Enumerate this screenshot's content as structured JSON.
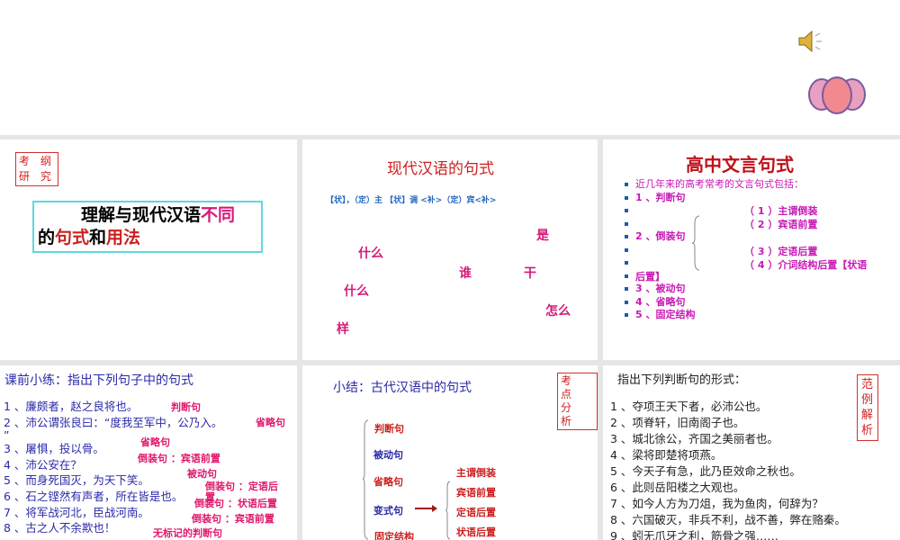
{
  "slides": [
    {
      "stamp": [
        "考 纲",
        "研 究"
      ],
      "title_parts": [
        "理解与现代汉语",
        "不同",
        "的",
        "句式",
        "和",
        "用法"
      ]
    },
    {
      "title": "现代汉语的句式",
      "formula": "【状】，（定）主 【状】调 <补>（定）宾<补>",
      "words": [
        "是",
        "什么",
        "谁",
        "干",
        "什么",
        "怎么",
        "样"
      ]
    },
    {
      "title": "高中文言句式",
      "bullets": [
        "近几年来的高考常考的文言句式包括：",
        "1 、判断句",
        "",
        "",
        "2 、倒装句",
        "",
        "",
        "3 、被动句",
        "4 、省略句",
        "5 、固定结构"
      ],
      "sub": [
        "（ 1 ）主谓倒装",
        "（ 2 ）宾语前置",
        "（ 3 ）定语后置",
        "（ 4 ）介词结构后置【状语",
        "后置】"
      ]
    },
    {
      "title": "课前小练：指出下列句子中的句式",
      "items": [
        "1 、廉颇者，赵之良将也。",
        "2 、沛公谓张良曰：“度我至军中，公乃入。",
        "”",
        "3 、屠惧，投以骨。",
        "4 、沛公安在？",
        "5 、而身死国灭，为天下笑。",
        "6 、石之铿然有声者，所在皆是也。",
        "7 、将军战河北，臣战河南。",
        "8 、古之人不余欺也！"
      ],
      "answers": [
        "判断句",
        "省略句",
        "省略句",
        "倒装句 ：宾语前置",
        "被动句",
        "倒装句 ：定语后",
        "置",
        "倒装句 ：状语后置",
        "倒装句 ：宾语前置",
        "无标记的判断句"
      ]
    },
    {
      "title": "小结：古代汉语中的句式",
      "stamp": [
        "考 点",
        "分 析"
      ],
      "types": [
        "判断句",
        "被动句",
        "省略句",
        "变式句",
        "固定结构"
      ],
      "sub": [
        "主谓倒装",
        "宾语前置",
        "定语后置",
        "状语后置"
      ]
    },
    {
      "title": "指出下列判断句的形式：",
      "stamp": [
        "范",
        "例",
        "解",
        "析"
      ],
      "items": [
        "1 、夺项王天下者，必沛公也。",
        "2 、项脊轩，旧南阁子也。",
        "3 、城北徐公，齐国之美丽者也。",
        "4 、梁将即楚将项燕。",
        "5 、今天子有急，此乃臣效命之秋也。",
        "6 、此则岳阳楼之大观也。",
        "7 、如今人方为刀俎，我为鱼肉，何辞为？",
        "8 、六国破灭，非兵不利，战不善，弊在赂秦。",
        "9 、蚓无爪牙之利，筋骨之强……"
      ]
    }
  ]
}
